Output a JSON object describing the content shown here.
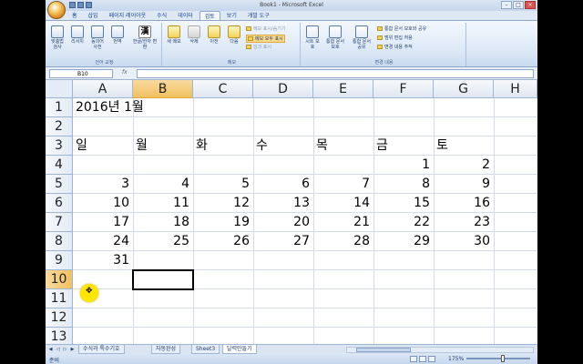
{
  "window": {
    "title": "Book1 - Microsoft Excel",
    "min_label": "–",
    "max_label": "□",
    "close_label": "×"
  },
  "ribbon_tabs": [
    "홈",
    "삽입",
    "페이지 레이아웃",
    "수식",
    "데이터",
    "검토",
    "보기",
    "개발 도구"
  ],
  "active_tab": "검토",
  "ribbon": {
    "proofing": {
      "buttons": [
        "맞춤법 검사",
        "리서치",
        "동의어 사전",
        "번역",
        "한글/한자 변환"
      ],
      "label": "언어 교정"
    },
    "comments": {
      "buttons": [
        "새 메모",
        "삭제",
        "이전",
        "다음"
      ],
      "options": [
        "메모 표시/숨기기",
        "메모 모두 표시",
        "잉크 표시"
      ],
      "label": "메모"
    },
    "changes": {
      "buttons": [
        "시트 보호",
        "통합 문서 보호",
        "통합 문서 공유"
      ],
      "options": [
        "통합 문서 보호와 공유",
        "범위 편집 허용",
        "변경 내용 추적"
      ],
      "label": "변경 내용"
    },
    "han_glyph": "漢"
  },
  "formula_bar": {
    "name_box": "B10",
    "fx": "fx",
    "value": ""
  },
  "columns": [
    "A",
    "B",
    "C",
    "D",
    "E",
    "F",
    "G",
    "H"
  ],
  "rows": [
    "1",
    "2",
    "3",
    "4",
    "5",
    "6",
    "7",
    "8",
    "9",
    "10",
    "11",
    "12",
    "13"
  ],
  "selected_column": "B",
  "selected_row": "10",
  "cells": {
    "title": "2016년 1월",
    "weekday_headers": [
      "일",
      "월",
      "화",
      "수",
      "목",
      "금",
      "토"
    ],
    "weeks": [
      [
        "",
        "",
        "",
        "",
        "",
        "1",
        "2"
      ],
      [
        "3",
        "4",
        "5",
        "6",
        "7",
        "8",
        "9"
      ],
      [
        "10",
        "11",
        "12",
        "13",
        "14",
        "15",
        "16"
      ],
      [
        "17",
        "18",
        "19",
        "20",
        "21",
        "22",
        "23"
      ],
      [
        "24",
        "25",
        "26",
        "27",
        "28",
        "29",
        "30"
      ],
      [
        "31",
        "",
        "",
        "",
        "",
        "",
        ""
      ]
    ]
  },
  "sheet_tabs": [
    "수식과 특수기호",
    "자동완성",
    "Sheet3",
    "달력만들기"
  ],
  "active_sheet": "달력만들기",
  "status": {
    "ready": "준비",
    "zoom": "175%"
  },
  "colors": {
    "accent": "#f1c15f",
    "cursor_highlight": "#ffe600"
  }
}
